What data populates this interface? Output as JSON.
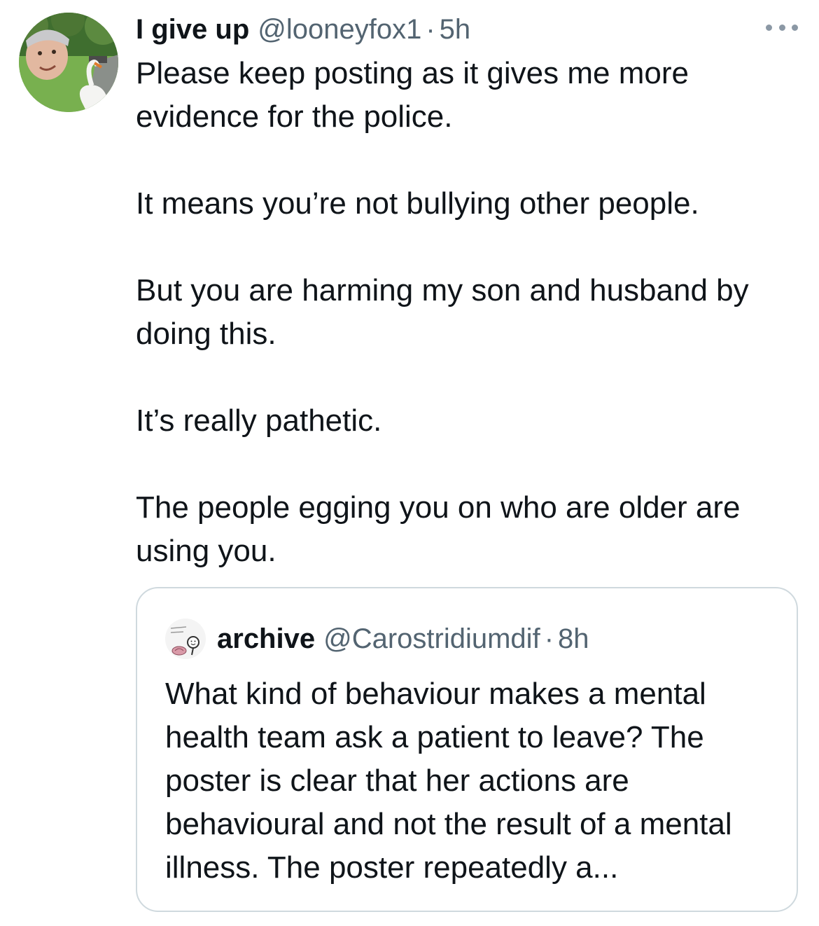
{
  "tweet": {
    "display_name": "I give up",
    "handle": "@looneyfox1",
    "separator": "·",
    "time": "5h",
    "avatar_icon": "user-photo-with-swan",
    "more_icon": "more-options-icon",
    "paragraphs": [
      "Please keep posting as it gives me more evidence for the police.",
      "It means you’re not bullying other people.",
      "But you are harming my son and husband by doing this.",
      "It’s really pathetic.",
      "The people egging you on who are older are using you."
    ]
  },
  "quoted_tweet": {
    "display_name": "archive",
    "handle": "@Carostridiumdif",
    "separator": "·",
    "time": "8h",
    "avatar_icon": "cartoon-drawing-avatar",
    "text": "What kind of behaviour makes a mental health team ask a patient to leave? The poster is clear that her actions are behavioural and not the result of a mental illness. The poster repeatedly a..."
  },
  "colors": {
    "text_primary": "#0f1419",
    "text_secondary": "#536471",
    "border": "#cfd9de",
    "background": "#ffffff"
  }
}
